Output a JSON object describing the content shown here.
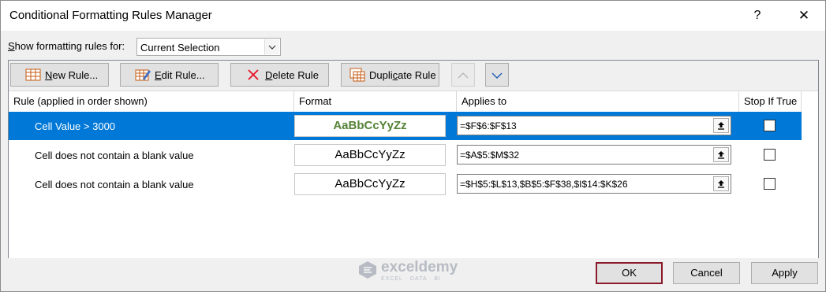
{
  "window": {
    "title": "Conditional Formatting Rules Manager",
    "help": "?",
    "close": "✕"
  },
  "show_rules": {
    "label_prefix": "S",
    "label_rest": "how formatting rules for:",
    "selected": "Current Selection"
  },
  "toolbar": {
    "new_rule": {
      "u": "N",
      "rest": "ew Rule..."
    },
    "edit_rule": {
      "u": "E",
      "rest": "dit Rule..."
    },
    "delete_rule": {
      "pre": "",
      "u": "D",
      "rest": "elete Rule"
    },
    "duplicate_rule": {
      "pre": "Dupli",
      "u": "c",
      "rest": "ate Rule"
    }
  },
  "columns": {
    "rule": "Rule (applied in order shown)",
    "format": "Format",
    "applies_to": "Applies to",
    "stop_if_true": "Stop If True"
  },
  "rules": [
    {
      "rule": "Cell Value > 3000",
      "format": "AaBbCcYyZz",
      "applies_to": "=$F$6:$F$13",
      "stop": false
    },
    {
      "rule": "Cell does not contain a blank value",
      "format": "AaBbCcYyZz",
      "applies_to": "=$A$5:$M$32",
      "stop": false
    },
    {
      "rule": "Cell does not contain a blank value",
      "format": "AaBbCcYyZz",
      "applies_to": "=$H$5:$L$13,$B$5:$F$38,$I$14:$K$26",
      "stop": false
    }
  ],
  "watermark": {
    "name": "exceldemy",
    "sub": "EXCEL · DATA · BI"
  },
  "buttons": {
    "ok": "OK",
    "cancel": "Cancel",
    "apply": "Apply"
  },
  "colors": {
    "selection": "#0078d7",
    "format_green": "#548235"
  }
}
